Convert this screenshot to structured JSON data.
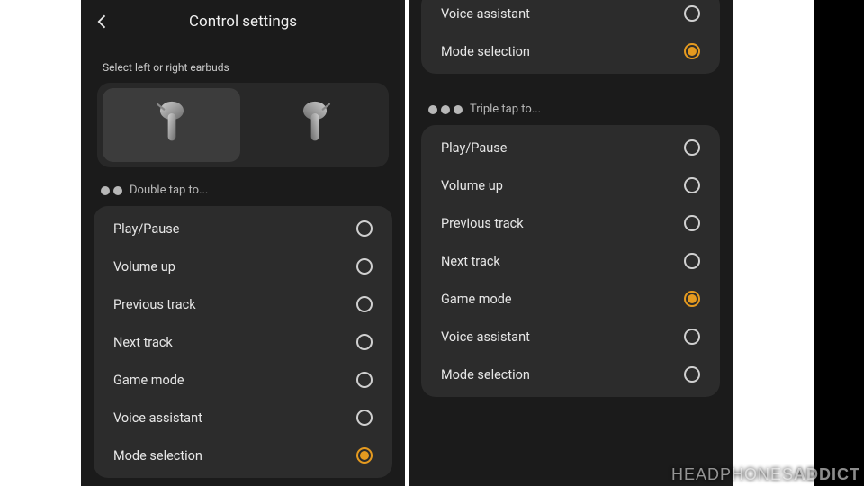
{
  "header": {
    "title": "Control settings"
  },
  "subtitle": "Select left or right earbuds",
  "earbuds": {
    "selected": "left"
  },
  "sections": {
    "double": {
      "label": "Double tap to..."
    },
    "triple": {
      "label": "Triple tap to..."
    }
  },
  "leftPanel": {
    "prevTail": [],
    "double": {
      "options": [
        {
          "label": "Play/Pause",
          "selected": false
        },
        {
          "label": "Volume up",
          "selected": false
        },
        {
          "label": "Previous track",
          "selected": false
        },
        {
          "label": "Next track",
          "selected": false
        },
        {
          "label": "Game mode",
          "selected": false
        },
        {
          "label": "Voice assistant",
          "selected": false
        },
        {
          "label": "Mode selection",
          "selected": true
        }
      ]
    }
  },
  "rightPanel": {
    "prevTail": [
      {
        "label": "Voice assistant",
        "selected": false
      },
      {
        "label": "Mode selection",
        "selected": true
      }
    ],
    "triple": {
      "options": [
        {
          "label": "Play/Pause",
          "selected": false
        },
        {
          "label": "Volume up",
          "selected": false
        },
        {
          "label": "Previous track",
          "selected": false
        },
        {
          "label": "Next track",
          "selected": false
        },
        {
          "label": "Game mode",
          "selected": true
        },
        {
          "label": "Voice assistant",
          "selected": false
        },
        {
          "label": "Mode selection",
          "selected": false
        }
      ]
    }
  },
  "watermark": {
    "a": "HEADPHONES",
    "b": "ADDICT"
  },
  "accent": "#e59a1f"
}
